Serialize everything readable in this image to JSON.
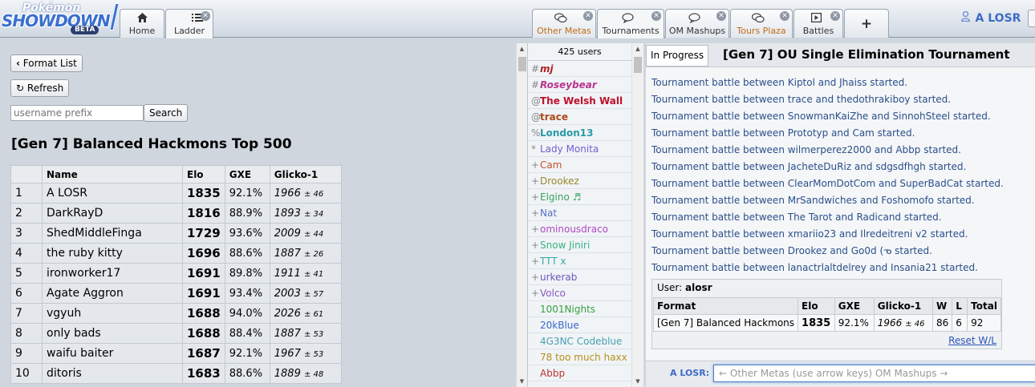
{
  "header": {
    "logo": {
      "line1": "Pokémon",
      "line2": "SHOWDOWN",
      "badge": "BETA"
    },
    "left_tabs": [
      {
        "label": "Home",
        "icon": "home-icon"
      },
      {
        "label": "Ladder",
        "icon": "list-icon"
      }
    ],
    "right_tabs": [
      {
        "label": "Other Metas",
        "icon": "chat-bubbles-icon"
      },
      {
        "label": "Tournaments",
        "icon": "chat-bubble-icon"
      },
      {
        "label": "OM Mashups",
        "icon": "chat-bubble-icon"
      },
      {
        "label": "Tours Plaza",
        "icon": "chat-bubbles-icon"
      },
      {
        "label": "Battles",
        "icon": "battle-icon"
      }
    ],
    "add_tab": "+",
    "user": "A LOSR"
  },
  "ladder": {
    "format_list_button": "Format List",
    "refresh_button": "Refresh",
    "search_placeholder": "username prefix",
    "search_button": "Search",
    "title": "[Gen 7] Balanced Hackmons Top 500",
    "columns": [
      "",
      "Name",
      "Elo",
      "GXE",
      "Glicko-1"
    ],
    "rows": [
      {
        "rank": "1",
        "name": "A LOSR",
        "elo": "1835",
        "gxe": "92.1%",
        "glicko": "1966",
        "dev": "± 46"
      },
      {
        "rank": "2",
        "name": "DarkRayD",
        "elo": "1816",
        "gxe": "88.9%",
        "glicko": "1893",
        "dev": "± 34"
      },
      {
        "rank": "3",
        "name": "ShedMiddleFinga",
        "elo": "1729",
        "gxe": "93.6%",
        "glicko": "2009",
        "dev": "± 44"
      },
      {
        "rank": "4",
        "name": "the ruby kitty",
        "elo": "1696",
        "gxe": "88.6%",
        "glicko": "1887",
        "dev": "± 26"
      },
      {
        "rank": "5",
        "name": "ironworker17",
        "elo": "1691",
        "gxe": "89.8%",
        "glicko": "1911",
        "dev": "± 41"
      },
      {
        "rank": "6",
        "name": "Agate Aggron",
        "elo": "1691",
        "gxe": "93.4%",
        "glicko": "2003",
        "dev": "± 57"
      },
      {
        "rank": "7",
        "name": "vgyuh",
        "elo": "1688",
        "gxe": "94.0%",
        "glicko": "2026",
        "dev": "± 61"
      },
      {
        "rank": "8",
        "name": "only bads",
        "elo": "1688",
        "gxe": "88.4%",
        "glicko": "1887",
        "dev": "± 53"
      },
      {
        "rank": "9",
        "name": "waifu baiter",
        "elo": "1687",
        "gxe": "92.1%",
        "glicko": "1967",
        "dev": "± 53"
      },
      {
        "rank": "10",
        "name": "ditoris",
        "elo": "1683",
        "gxe": "88.6%",
        "glicko": "1889",
        "dev": "± 48"
      }
    ]
  },
  "userlist": {
    "count": "425 users",
    "users": [
      {
        "group": "#",
        "name": "mj",
        "color": "#b02020",
        "bold": true,
        "italic": true
      },
      {
        "group": "#",
        "name": "Roseybear",
        "color": "#b8348c",
        "bold": true,
        "italic": true
      },
      {
        "group": "@",
        "name": "The Welsh Wall",
        "color": "#c0102a",
        "bold": true,
        "italic": false
      },
      {
        "group": "@",
        "name": "trace",
        "color": "#b04818",
        "bold": true,
        "italic": false
      },
      {
        "group": "%",
        "name": "London13",
        "color": "#2a9aa8",
        "bold": true,
        "italic": false
      },
      {
        "group": "*",
        "name": "Lady Monita",
        "color": "#6f60d0",
        "bold": false,
        "italic": false
      },
      {
        "group": "+",
        "name": "Cam",
        "color": "#c8502a",
        "bold": false,
        "italic": false
      },
      {
        "group": "+",
        "name": "Drookez",
        "color": "#9a8a2a",
        "bold": false,
        "italic": false
      },
      {
        "group": "+",
        "name": "Elgino ♬",
        "color": "#3aa060",
        "bold": false,
        "italic": false
      },
      {
        "group": "+",
        "name": "Nat",
        "color": "#5a70c8",
        "bold": false,
        "italic": false
      },
      {
        "group": "+",
        "name": "ominousdraco",
        "color": "#b04ac0",
        "bold": false,
        "italic": false
      },
      {
        "group": "+",
        "name": "Snow Jiniri",
        "color": "#3ab080",
        "bold": false,
        "italic": false
      },
      {
        "group": "+",
        "name": "TTT x",
        "color": "#3aa8a0",
        "bold": false,
        "italic": false
      },
      {
        "group": "+",
        "name": "urkerab",
        "color": "#6a58b8",
        "bold": false,
        "italic": false
      },
      {
        "group": "+",
        "name": "Volco",
        "color": "#8a58c0",
        "bold": false,
        "italic": false
      },
      {
        "group": "",
        "name": "1001Nights",
        "color": "#3aa040",
        "bold": false,
        "italic": false
      },
      {
        "group": "",
        "name": "20kBlue",
        "color": "#3a68c8",
        "bold": false,
        "italic": false
      },
      {
        "group": "",
        "name": "4G3NC Codeblue",
        "color": "#48a0b0",
        "bold": false,
        "italic": false
      },
      {
        "group": "",
        "name": "78 too much haxx",
        "color": "#b8901a",
        "bold": false,
        "italic": false
      },
      {
        "group": "",
        "name": "Abbp",
        "color": "#c03030",
        "bold": false,
        "italic": false
      }
    ]
  },
  "chat": {
    "in_progress_button": "In Progress",
    "title": "[Gen 7] OU Single Elimination Tournament",
    "messages": [
      "Tournament battle between Kiptol and Jhaiss started.",
      "Tournament battle between trace and thedothrakiboy started.",
      "Tournament battle between SnowmanKaiZhe and SinnohSteel started.",
      "Tournament battle between Prototyp and Cam started.",
      "Tournament battle between wilmerperez2000 and Abbp started.",
      "Tournament battle between JacheteDuRiz and sdgsdfhgh started.",
      "Tournament battle between ClearMomDotCom and SuperBadCat started.",
      "Tournament battle between MrSandwiches and Foshomofo started.",
      "Tournament battle between The Tarot and Radicand started.",
      "Tournament battle between xmariio23 and Ilredeitreni v2 started.",
      "Tournament battle between Drookez and Go0d (ᓀ started.",
      "Tournament battle between lanactrlaltdelrey and Insania21 started."
    ],
    "user_box": {
      "label": "User:",
      "username": "alosr",
      "columns": [
        "Format",
        "Elo",
        "GXE",
        "Glicko-1",
        "W",
        "L",
        "Total"
      ],
      "row": {
        "format": "[Gen 7] Balanced Hackmons",
        "elo": "1835",
        "gxe": "92.1%",
        "glicko": "1966",
        "dev": "± 46",
        "w": "86",
        "l": "6",
        "total": "92"
      },
      "reset": "Reset W/L"
    },
    "input_name": "A LOSR:",
    "input_placeholder": "← Other Metas (use arrow keys) OM Mashups →"
  },
  "colors": {
    "accent": "#3f6bc6",
    "chat_text": "#2c4f8a",
    "tab_orange": "#c06d15"
  }
}
